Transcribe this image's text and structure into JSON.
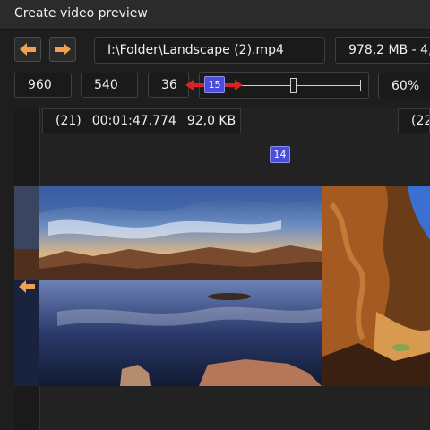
{
  "window": {
    "title": "Create video preview"
  },
  "toolbar": {
    "prev_icon": "arrow-left-icon",
    "next_icon": "arrow-right-icon",
    "file_path": "I:\\Folder\\Landscape (2).mp4",
    "file_info": "978,2 MB - 4,",
    "width_value": "960",
    "height_value": "540",
    "frame_count": "36",
    "slider_badge": "15",
    "slider_level": 0.48,
    "zoom_value": "60%"
  },
  "timeline": {
    "marker_badge": "14",
    "frames": [
      {
        "index_label": "(21)",
        "timecode": "00:01:47.774",
        "size": "92,0 KB"
      },
      {
        "index_label": "(22"
      }
    ]
  },
  "colors": {
    "accent_orange": "#f0a050",
    "badge_blue": "#4a4ed8",
    "drag_arrows": "#e02020"
  }
}
